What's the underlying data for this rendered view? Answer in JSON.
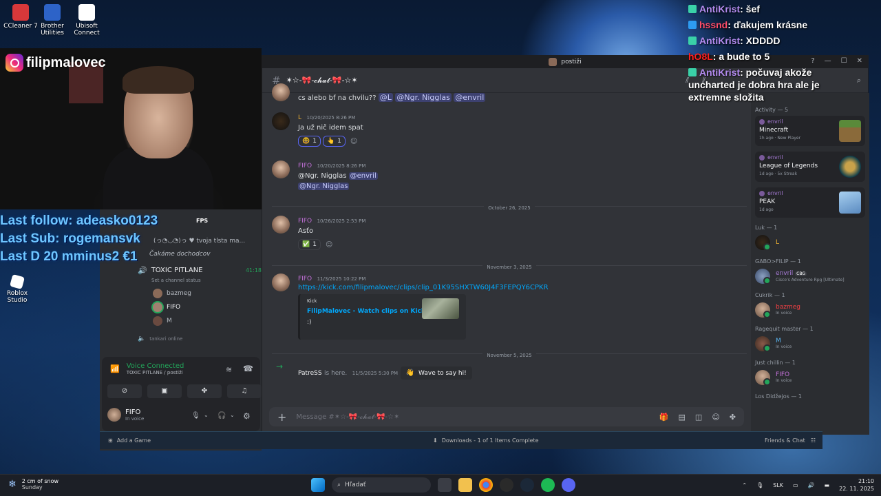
{
  "desktop_icons": [
    {
      "label": "CCleaner 7",
      "color": "#d8383a"
    },
    {
      "label": "Brother Utilities",
      "color": "#2d63c8"
    },
    {
      "label": "Ubisoft Connect",
      "color": "#ffffff"
    }
  ],
  "desktop_icons_lower": [
    {
      "label": "Roblox Studio",
      "color": "#ffffff"
    }
  ],
  "instagram_handle": "filipmalovec",
  "overlay": {
    "line1": "Last follow: adeasko0123",
    "line2": "Last Sub: rogemansvk",
    "line3": "Last D 20 mminus2 €1"
  },
  "stream_chat": [
    {
      "user": "AntiKrist",
      "user_color": "#b48cf0",
      "message": ": šef"
    },
    {
      "user": "hssnd",
      "user_color": "#ff4d6a",
      "message": ": ďakujem krásne"
    },
    {
      "user": "AntiKrist",
      "user_color": "#b48cf0",
      "message": ": XDDDD"
    },
    {
      "user": "hO8L",
      "user_color": "#ff2020",
      "message": ": a bude to 5"
    },
    {
      "user": "AntiKrist",
      "user_color": "#b48cf0",
      "message": ": počuvaj akože uncharted je dobra hra ale je extremne složita"
    }
  ],
  "discord_left": {
    "fps_label": "FPS",
    "status_text": "(っ◔◡◔)っ ♥ tvoja tlsta ma...",
    "status_text2": "Čakáme dochodcov",
    "voice_channel": {
      "name": "TOXIC PITLANE",
      "time": "41:18",
      "status": "Set a channel status"
    },
    "voice_users": [
      "bazmeg",
      "FIFO",
      "M"
    ],
    "next_channel": "tankari online",
    "voice_connected": "Voice Connected",
    "voice_sub": "TOXIC PITLANE / postiži",
    "user_name": "FIFO",
    "user_status": "In voice"
  },
  "discord": {
    "window_title": "postiži",
    "channel_name": "✶☆-🎀-𝓬𝓱𝓪𝓽-🎀-☆✶",
    "messages": [
      {
        "text_prefix": "cs alebo bf na chvilu?? ",
        "mentions": [
          "@L",
          "@Ngr. Nigglas",
          "@envril"
        ]
      },
      {
        "author": "L",
        "author_color": "#f0b232",
        "time": "10/20/2025 8:26 PM",
        "text": "Ja už nič idem spat",
        "reactions": [
          {
            "emoji": "🤓",
            "count": "1"
          },
          {
            "emoji": "👆",
            "count": "1"
          }
        ]
      },
      {
        "author": "FIFO",
        "author_color": "#c270d8",
        "time": "10/20/2025 8:26 PM",
        "text": "@Ngr. Nigglas",
        "mention2": "@envril",
        "line2": "@Ngr. Nigglas"
      },
      {
        "author": "FIFO",
        "author_color": "#c270d8",
        "time": "10/26/2025 2:53 PM",
        "text": "Asťo",
        "reactions": [
          {
            "emoji": "✅",
            "count": "1"
          }
        ]
      },
      {
        "author": "FIFO",
        "author_color": "#c270d8",
        "time": "11/3/2025 10:22 PM",
        "link": "https://kick.com/filipmalovec/clips/clip_01K95SHXTW60J4F3FEPQY6CPKR",
        "embed_provider": "Kick",
        "embed_title": "FilipMalovec - Watch clips on Kick",
        "embed_desc": ":)"
      },
      {
        "author": "PatreSS",
        "system_text": "is here.",
        "time": "11/5/2025 5:30 PM",
        "button": "Wave to say hi!"
      }
    ],
    "dates": [
      "October 26, 2025",
      "November 3, 2025",
      "November 5, 2025"
    ],
    "composer_placeholder": "Message #✶☆-🎀-𝓬𝓱𝓪𝓽-🎀-☆✶"
  },
  "members": {
    "activity_header": "Activity — 5",
    "activities": [
      {
        "user": "envril",
        "game": "Minecraft",
        "meta": "1h ago",
        "extra": "New Player",
        "art": "#5a8a3a"
      },
      {
        "user": "envril",
        "game": "League of Legends",
        "meta": "1d ago",
        "extra": "5x Streak",
        "art": "#0a3a4a"
      },
      {
        "user": "envril",
        "game": "PEAK",
        "meta": "1d ago",
        "extra": "",
        "art": "#7ab0e0"
      }
    ],
    "groups": [
      {
        "header": "Luk — 1",
        "name": "L",
        "name_color": "#f0b232",
        "sub": ""
      },
      {
        "header": "GABO>FILIP — 1",
        "name": "envril",
        "name_color": "#a77bd6",
        "tag": "CBG",
        "sub": "Cisco's Adventure Rpg [Ultimate]"
      },
      {
        "header": "Cukrik — 1",
        "name": "bazmeg",
        "name_color": "#f23f43",
        "sub": "In voice"
      },
      {
        "header": "Ragequit master — 1",
        "name": "M",
        "name_color": "#5ab4f0",
        "sub": "In voice"
      },
      {
        "header": "Just chillin — 1",
        "name": "FIFO",
        "name_color": "#c270d8",
        "sub": "In voice"
      },
      {
        "header": "Los Didžejos — 1",
        "name": "",
        "name_color": "#ffffff",
        "sub": ""
      }
    ]
  },
  "steam_bar": {
    "add_game": "Add a Game",
    "downloads": "Downloads - 1 of 1 Items Complete",
    "friends": "Friends & Chat"
  },
  "taskbar": {
    "weather_title": "2 cm of snow",
    "weather_sub": "Sunday",
    "search_placeholder": "Hľadať",
    "lang": "SLK",
    "time": "21:10",
    "date": "22. 11. 2025"
  }
}
